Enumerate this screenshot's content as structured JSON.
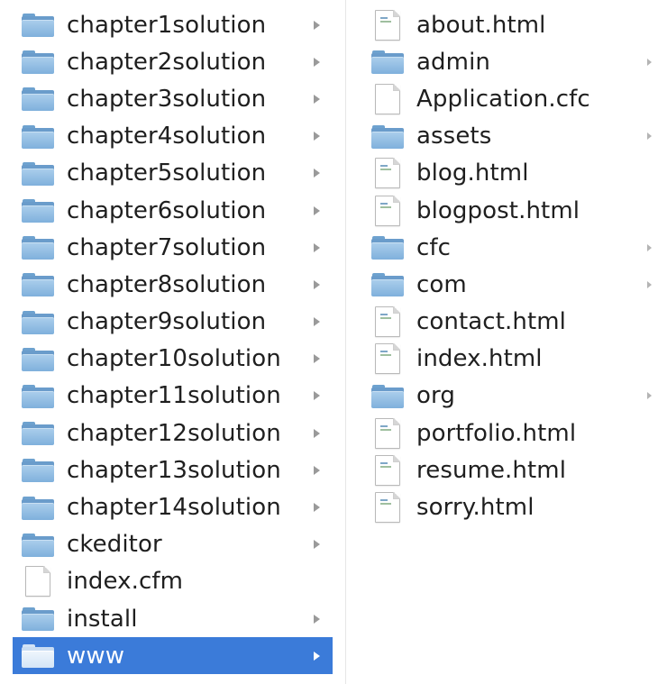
{
  "left_column": {
    "items": [
      {
        "label": "chapter1solution",
        "type": "folder",
        "has_children": true,
        "selected": false
      },
      {
        "label": "chapter2solution",
        "type": "folder",
        "has_children": true,
        "selected": false
      },
      {
        "label": "chapter3solution",
        "type": "folder",
        "has_children": true,
        "selected": false
      },
      {
        "label": "chapter4solution",
        "type": "folder",
        "has_children": true,
        "selected": false
      },
      {
        "label": "chapter5solution",
        "type": "folder",
        "has_children": true,
        "selected": false
      },
      {
        "label": "chapter6solution",
        "type": "folder",
        "has_children": true,
        "selected": false
      },
      {
        "label": "chapter7solution",
        "type": "folder",
        "has_children": true,
        "selected": false
      },
      {
        "label": "chapter8solution",
        "type": "folder",
        "has_children": true,
        "selected": false
      },
      {
        "label": "chapter9solution",
        "type": "folder",
        "has_children": true,
        "selected": false
      },
      {
        "label": "chapter10solution",
        "type": "folder",
        "has_children": true,
        "selected": false
      },
      {
        "label": "chapter11solution",
        "type": "folder",
        "has_children": true,
        "selected": false
      },
      {
        "label": "chapter12solution",
        "type": "folder",
        "has_children": true,
        "selected": false
      },
      {
        "label": "chapter13solution",
        "type": "folder",
        "has_children": true,
        "selected": false
      },
      {
        "label": "chapter14solution",
        "type": "folder",
        "has_children": true,
        "selected": false
      },
      {
        "label": "ckeditor",
        "type": "folder",
        "has_children": true,
        "selected": false
      },
      {
        "label": "index.cfm",
        "type": "file",
        "has_children": false,
        "selected": false
      },
      {
        "label": "install",
        "type": "folder",
        "has_children": true,
        "selected": false
      },
      {
        "label": "www",
        "type": "folder",
        "has_children": true,
        "selected": true
      }
    ]
  },
  "right_column": {
    "items": [
      {
        "label": "about.html",
        "type": "html-file",
        "has_children": false
      },
      {
        "label": "admin",
        "type": "folder",
        "has_children": true
      },
      {
        "label": "Application.cfc",
        "type": "file",
        "has_children": false
      },
      {
        "label": "assets",
        "type": "folder",
        "has_children": true
      },
      {
        "label": "blog.html",
        "type": "html-file",
        "has_children": false
      },
      {
        "label": "blogpost.html",
        "type": "html-file",
        "has_children": false
      },
      {
        "label": "cfc",
        "type": "folder",
        "has_children": true
      },
      {
        "label": "com",
        "type": "folder",
        "has_children": true
      },
      {
        "label": "contact.html",
        "type": "html-file",
        "has_children": false
      },
      {
        "label": "index.html",
        "type": "html-file",
        "has_children": false
      },
      {
        "label": "org",
        "type": "folder",
        "has_children": true
      },
      {
        "label": "portfolio.html",
        "type": "html-file",
        "has_children": false
      },
      {
        "label": "resume.html",
        "type": "html-file",
        "has_children": false
      },
      {
        "label": "sorry.html",
        "type": "html-file",
        "has_children": false
      }
    ]
  },
  "colors": {
    "selection": "#3b7bd9",
    "folder": "#7fb0dc",
    "text": "#1f1f1f"
  },
  "icons": {
    "folder": "folder-icon",
    "file": "file-icon",
    "html-file": "html-file-icon",
    "disclosure": "chevron-right-icon"
  }
}
